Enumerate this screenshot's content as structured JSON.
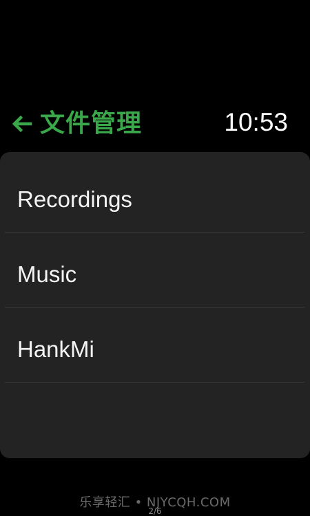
{
  "header": {
    "title": "文件管理",
    "back_icon": "arrow-left-icon",
    "time": "10:53",
    "accent_color": "#3aa84a"
  },
  "list": {
    "items": [
      {
        "label": "Recordings"
      },
      {
        "label": "Music"
      },
      {
        "label": "HankMi"
      }
    ]
  },
  "footer": {
    "watermark": "乐享轻汇 • NJYCQH.COM",
    "page_indicator": "2/6"
  }
}
